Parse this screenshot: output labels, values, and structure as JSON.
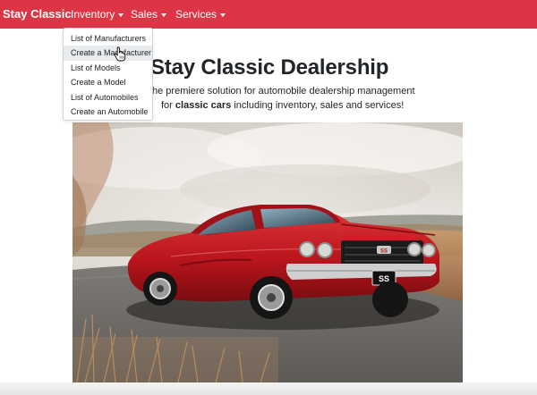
{
  "navbar": {
    "brand": "Stay Classic",
    "items": [
      {
        "label": "Inventory"
      },
      {
        "label": "Sales"
      },
      {
        "label": "Services"
      }
    ],
    "color": "#dc3545"
  },
  "inventory_menu": {
    "items": [
      {
        "label": "List of Manufacturers"
      },
      {
        "label": "Create a Manufacturer"
      },
      {
        "label": "List of Models"
      },
      {
        "label": "Create a Model"
      },
      {
        "label": "List of Automobiles"
      },
      {
        "label": "Create an Automobile"
      }
    ],
    "hovered_index": 1
  },
  "hero": {
    "title": "Stay Classic Dealership",
    "lead_line1": "he premiere solution for automobile dealership management",
    "lead_line2_prefix": "for ",
    "lead_line2_bold": "classic cars",
    "lead_line2_suffix": " including inventory, sales and services!"
  },
  "photo": {
    "plate": "SS",
    "badge": "SS"
  },
  "icons": {
    "cursor": "hand-pointer-icon"
  }
}
